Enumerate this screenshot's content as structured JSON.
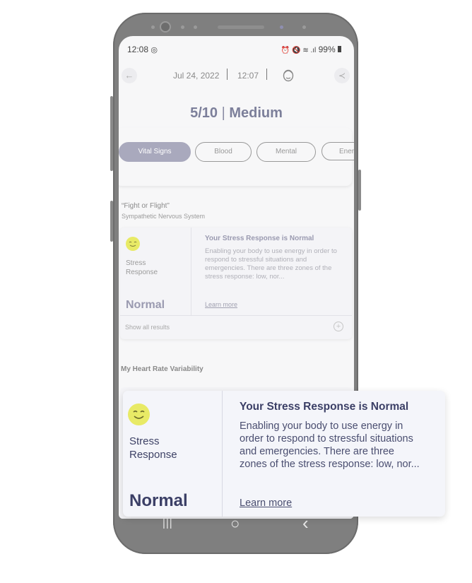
{
  "status_bar": {
    "time": "12:08",
    "icons": "⏰ 🔇 ≋ .ıl",
    "battery": "99%"
  },
  "header": {
    "date": "Jul 24, 2022",
    "time": "12:07",
    "back_icon": "arrow-left-icon",
    "share_icon": "share-icon"
  },
  "score": {
    "value": "5/10",
    "separator": "|",
    "level": "Medium"
  },
  "tabs": [
    {
      "label": "Vital Signs",
      "active": true
    },
    {
      "label": "Blood",
      "active": false
    },
    {
      "label": "Mental",
      "active": false
    },
    {
      "label": "Ener",
      "active": false
    }
  ],
  "section": {
    "title": "“Fight or Flight”",
    "subtitle": "Sympathetic Nervous System"
  },
  "stress_card": {
    "label_line1": "Stress",
    "label_line2": "Response",
    "status": "Normal",
    "heading": "Your Stress Response is Normal",
    "body": "Enabling your body to use energy in order to respond to stressful situations and emergencies. There are three zones of the stress response: low, nor...",
    "link": "Learn more",
    "show_all": "Show all results"
  },
  "hrv_title": "My Heart Rate Variability",
  "zoom_card": {
    "label_line1": "Stress",
    "label_line2": "Response",
    "status": "Normal",
    "heading": "Your Stress Response is Normal",
    "body_lines": [
      "Enabling your body to use energy in",
      "order to respond to stressful situations",
      "and emergencies. There are three",
      "zones of the stress response: low, nor..."
    ],
    "link": "Learn more"
  },
  "colors": {
    "accent": "#a9a9bd",
    "title": "#3b3f66",
    "face": "#e8ea66"
  },
  "nav": {
    "recent": "|||",
    "home": "○",
    "back": "‹"
  }
}
